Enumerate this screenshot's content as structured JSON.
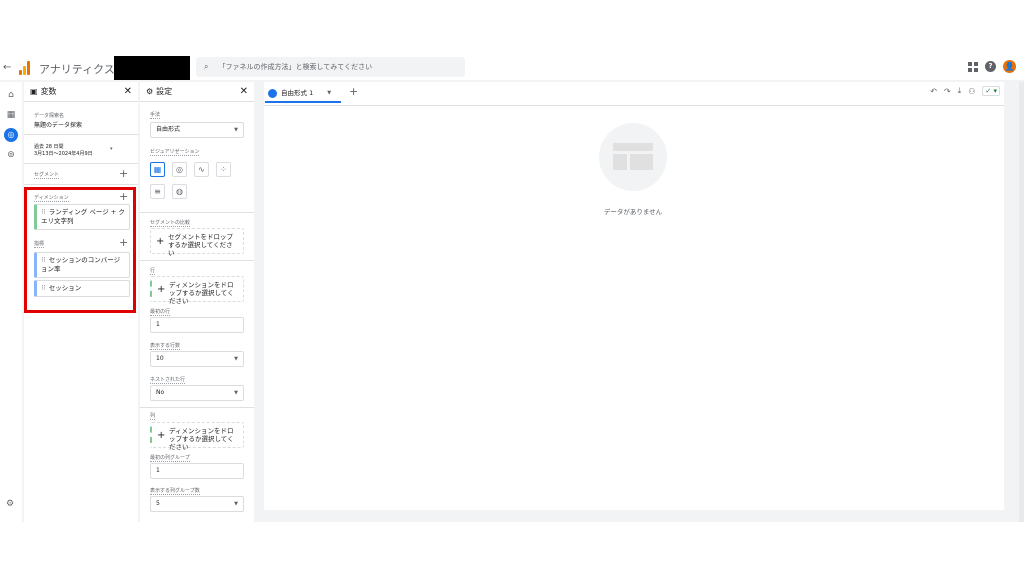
{
  "topbar": {
    "back": "←",
    "app_title": "アナリティクス",
    "search_placeholder": "「ファネルの作成方法」と検索してみてください",
    "search_icon": "search-icon",
    "help": "?",
    "user": "👤"
  },
  "variables_panel": {
    "title": "変数",
    "close": "✕",
    "exploration_name_label": "データ探索名",
    "exploration_name": "無題のデータ探索",
    "date_label": "過去 28 日間",
    "date_range": "3月13日～2024年4月9日",
    "segments_label": "セグメント",
    "dimensions_label": "ディメンション",
    "dimensions": [
      "ランディング ページ + クエリ文字列"
    ],
    "metrics_label": "指標",
    "metrics": [
      "セッションのコンバージョン率",
      "セッション"
    ]
  },
  "settings_panel": {
    "title": "設定",
    "close": "✕",
    "technique_label": "手法",
    "technique": "自由形式",
    "visualization_label": "ビジュアリゼーション",
    "segment_compare_label": "セグメントの比較",
    "segment_drop": "セグメントをドロップするか選択してください",
    "rows_label": "行",
    "rows_drop": "ディメンションをドロップするか選択してください",
    "start_row_label": "最初の行",
    "start_row": "1",
    "show_rows_label": "表示する行数",
    "show_rows": "10",
    "nested_rows_label": "ネストされた行",
    "nested_rows": "No",
    "columns_label": "列",
    "columns_drop": "ディメンションをドロップするか選択してください",
    "start_col_group_label": "最初の列グループ",
    "start_col_group": "1",
    "show_col_groups_label": "表示する列グループ数",
    "show_col_groups": "5"
  },
  "canvas": {
    "tab_label": "自由形式 1",
    "add_tab": "+",
    "empty_text": "データがありません"
  },
  "colors": {
    "accent": "#1a73e8",
    "highlight_box": "#e00000",
    "dimension_chip": "#81c995",
    "metric_chip": "#8ab4f8"
  }
}
